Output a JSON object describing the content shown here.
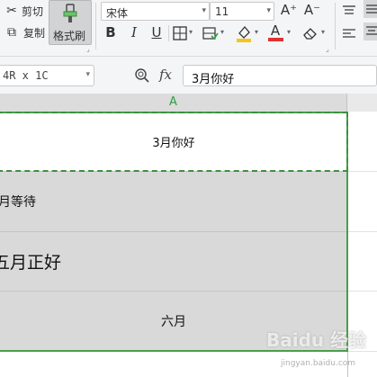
{
  "ribbon": {
    "cut_label": "剪切",
    "copy_label": "复制",
    "format_painter_label": "格式刷",
    "font_name": "宋体",
    "font_size": "11",
    "bold_glyph": "B",
    "italic_glyph": "I",
    "underline_glyph": "U",
    "font_color_glyph": "A",
    "increase_font_glyph": "A⁺",
    "decrease_font_glyph": "A⁻",
    "font_color": "#e03131",
    "highlight_color": "#f5c518"
  },
  "formula_bar": {
    "name_box": "4R x 1C",
    "fx_label": "fx",
    "formula_value": "3月你好"
  },
  "sheet": {
    "column_header": "A",
    "accent_color": "#4a9e4a",
    "cells": [
      {
        "text": "3月你好"
      },
      {
        "text": "月等待"
      },
      {
        "text": "五月正好"
      },
      {
        "text": "六月"
      }
    ]
  },
  "watermark": {
    "text": "Baidu 经验",
    "subtext": "jingyan.baidu.com"
  }
}
